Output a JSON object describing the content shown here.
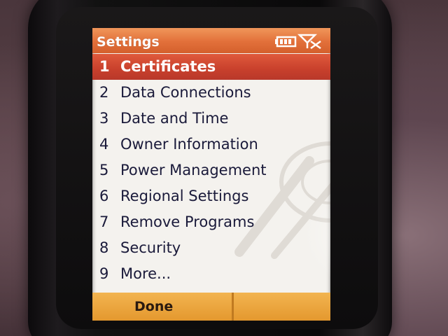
{
  "screen": {
    "title": "Settings",
    "icons": [
      "battery-icon",
      "signal-icon"
    ]
  },
  "menu": {
    "items": [
      {
        "num": "1",
        "label": "Certificates",
        "selected": true
      },
      {
        "num": "2",
        "label": "Data Connections",
        "selected": false
      },
      {
        "num": "3",
        "label": "Date and Time",
        "selected": false
      },
      {
        "num": "4",
        "label": "Owner Information",
        "selected": false
      },
      {
        "num": "5",
        "label": "Power Management",
        "selected": false
      },
      {
        "num": "6",
        "label": "Regional Settings",
        "selected": false
      },
      {
        "num": "7",
        "label": "Remove Programs",
        "selected": false
      },
      {
        "num": "8",
        "label": "Security",
        "selected": false
      },
      {
        "num": "9",
        "label": "More...",
        "selected": false
      }
    ]
  },
  "softkeys": {
    "left": "Done",
    "right": ""
  },
  "colors": {
    "titlebar": "#e2703a",
    "selection": "#c8402c",
    "softkeys": "#e4982e",
    "text": "#1a1a3a"
  }
}
